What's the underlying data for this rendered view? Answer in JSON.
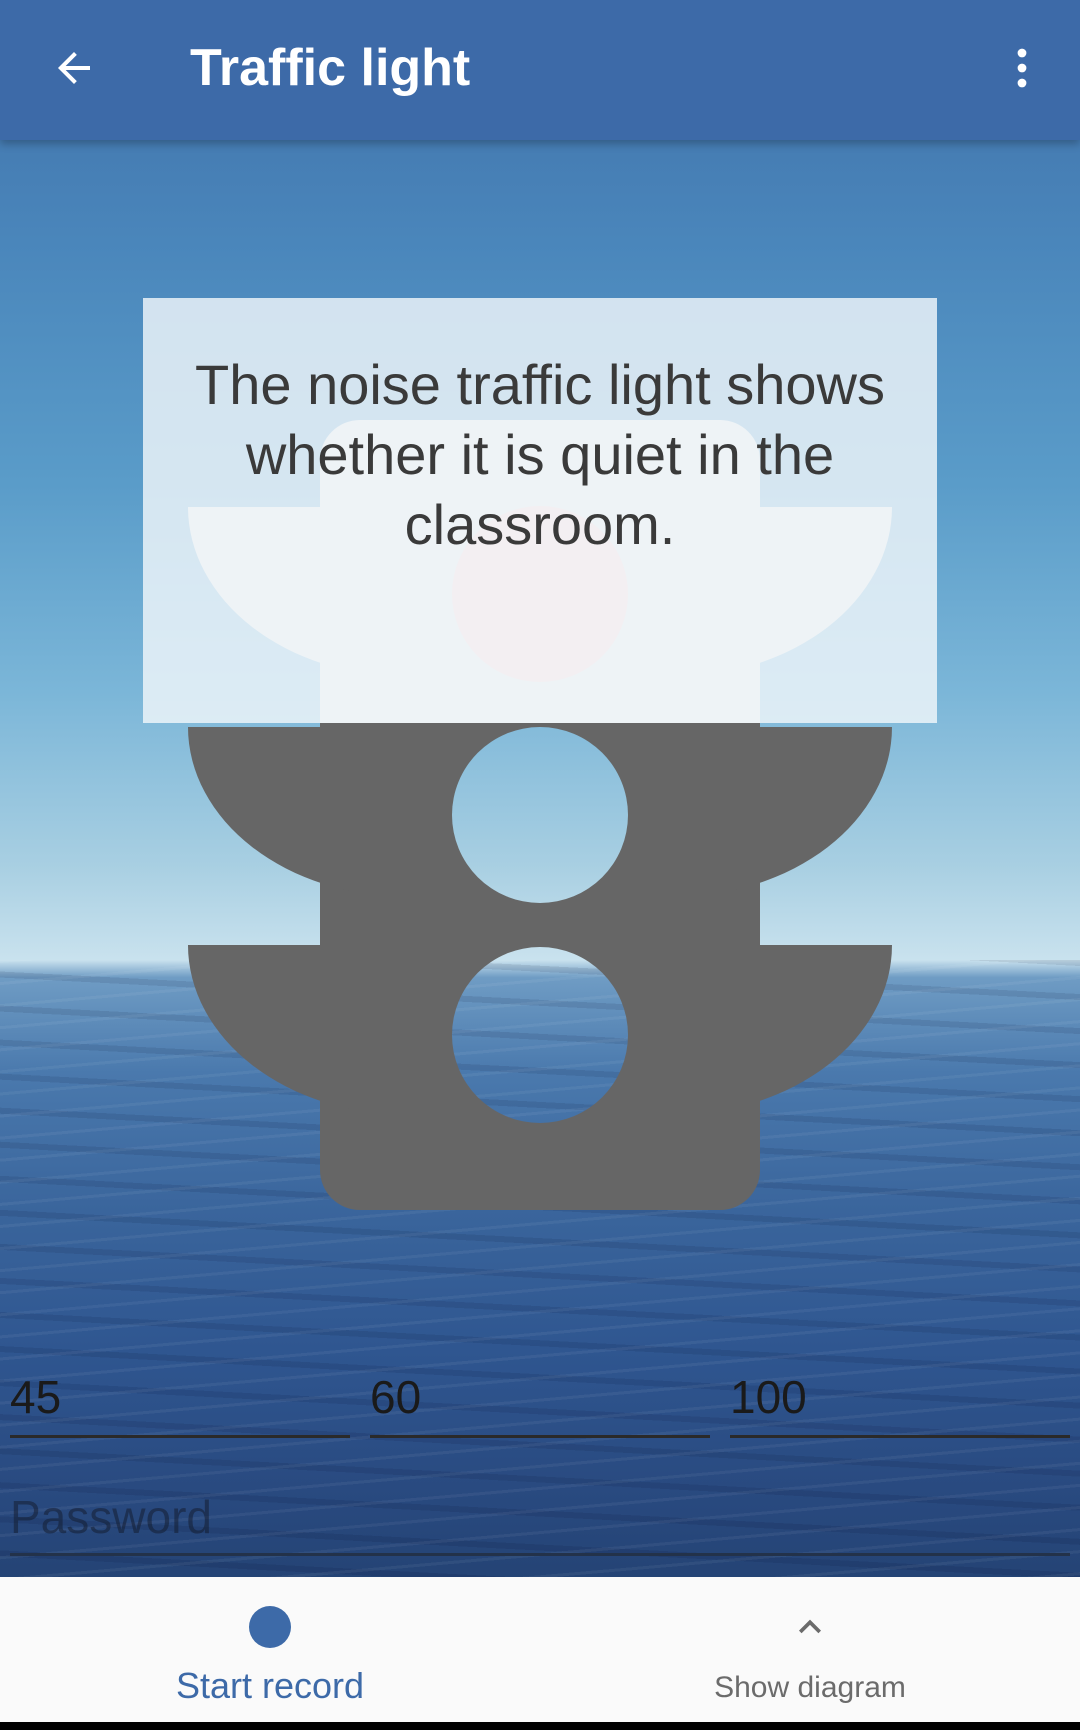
{
  "app_bar": {
    "title": "Traffic light",
    "back_icon": "arrow-back-icon",
    "menu_icon": "more-vert-icon",
    "color": "#3d6aa8"
  },
  "info": {
    "text": "The noise traffic light shows whether it is quiet in the classroom."
  },
  "traffic_light": {
    "active_lamp": "red",
    "lamps": [
      "red",
      "yellow",
      "green"
    ],
    "housing_color": "#666666",
    "active_lamp_color": "#ffcccc"
  },
  "thresholds": {
    "field1": "45",
    "field2": "60",
    "field3": "100"
  },
  "password": {
    "placeholder": "Password",
    "value": ""
  },
  "bottom_nav": {
    "start_record": {
      "label": "Start record",
      "icon": "record-dot-icon"
    },
    "show_diagram": {
      "label": "Show diagram",
      "icon": "chevron-up-icon"
    }
  }
}
